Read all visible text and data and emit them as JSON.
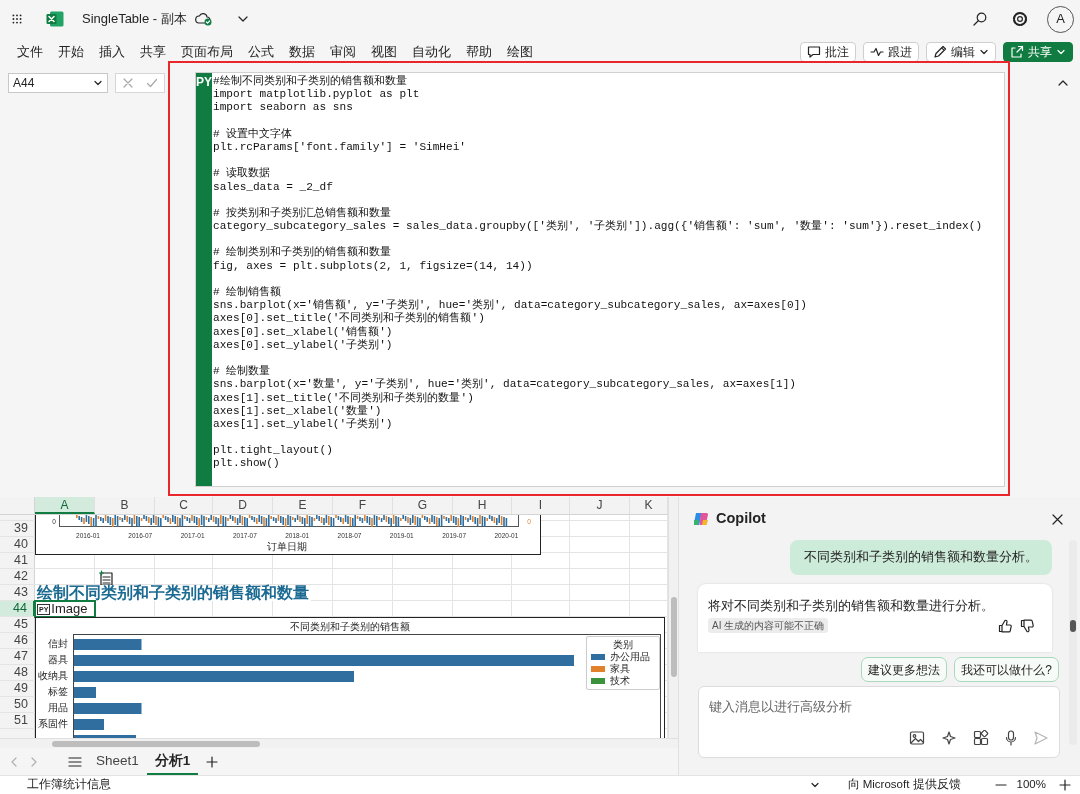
{
  "app_bar": {
    "title": "SingleTable - 副本",
    "avatar": "A"
  },
  "menu": [
    "文件",
    "开始",
    "插入",
    "共享",
    "页面布局",
    "公式",
    "数据",
    "审阅",
    "视图",
    "自动化",
    "帮助",
    "绘图"
  ],
  "ribbon_buttons": [
    {
      "label": "批注",
      "kind": "outline"
    },
    {
      "label": "跟进",
      "kind": "outline"
    },
    {
      "label": "编辑",
      "kind": "dropdown"
    },
    {
      "label": "共享",
      "kind": "primary"
    }
  ],
  "formula_bar": {
    "name_box": "A44",
    "editor": {
      "badge": "PY",
      "blocks": [
        [
          "#绘制不同类别和子类别的销售额和数量",
          "import matplotlib.pyplot as plt",
          "import seaborn as sns"
        ],
        [
          "# 设置中文字体",
          "plt.rcParams['font.family'] = 'SimHei'"
        ],
        [
          "# 读取数据",
          "sales_data = _2_df"
        ],
        [
          "# 按类别和子类别汇总销售额和数量",
          "category_subcategory_sales = sales_data.groupby(['类别', '子类别']).agg({'销售额': 'sum', '数量': 'sum'}).reset_index()"
        ],
        [
          "# 绘制类别和子类别的销售额和数量",
          "fig, axes = plt.subplots(2, 1, figsize=(14, 14))"
        ],
        [
          "# 绘制销售额",
          "sns.barplot(x='销售额', y='子类别', hue='类别', data=category_subcategory_sales, ax=axes[0])",
          "axes[0].set_title('不同类别和子类别的销售额')",
          "axes[0].set_xlabel('销售额')",
          "axes[0].set_ylabel('子类别')"
        ],
        [
          "# 绘制数量",
          "sns.barplot(x='数量', y='子类别', hue='类别', data=category_subcategory_sales, ax=axes[1])",
          "axes[1].set_title('不同类别和子类别的数量')",
          "axes[1].set_xlabel('数量')",
          "axes[1].set_ylabel('子类别')"
        ],
        [
          "plt.tight_layout()",
          "plt.show()"
        ]
      ]
    }
  },
  "sheet": {
    "columns": [
      {
        "label": "A",
        "selected": true
      },
      {
        "label": "B",
        "selected": false
      },
      {
        "label": "C",
        "selected": false
      },
      {
        "label": "D",
        "selected": false
      },
      {
        "label": "E",
        "selected": false
      },
      {
        "label": "F",
        "selected": false
      },
      {
        "label": "G",
        "selected": false
      },
      {
        "label": "H",
        "selected": false
      },
      {
        "label": "I",
        "selected": false
      },
      {
        "label": "J",
        "selected": false
      },
      {
        "label": "K",
        "selected": false
      }
    ],
    "rows": [
      {
        "label": "39",
        "selected": false
      },
      {
        "label": "40",
        "selected": false
      },
      {
        "label": "41",
        "selected": false
      },
      {
        "label": "42",
        "selected": false
      },
      {
        "label": "43",
        "selected": false
      },
      {
        "label": "44",
        "selected": true
      },
      {
        "label": "45",
        "selected": false
      },
      {
        "label": "46",
        "selected": false
      },
      {
        "label": "47",
        "selected": false
      },
      {
        "label": "48",
        "selected": false
      },
      {
        "label": "49",
        "selected": false
      },
      {
        "label": "50",
        "selected": false
      },
      {
        "label": "51",
        "selected": false
      }
    ],
    "heading": "绘制不同类别和子类别的销售额和数量",
    "active_cell": {
      "badge": "PY",
      "value": "Image"
    },
    "timeline_chart": {
      "left_tick": "0",
      "right_tick": "0",
      "xticks": [
        "2016-01",
        "2016-07",
        "2017-01",
        "2017-07",
        "2018-01",
        "2018-07",
        "2019-01",
        "2019-07",
        "2020-01"
      ],
      "xlabel": "订单日期"
    },
    "bar_chart": {
      "title": "不同类别和子类别的销售额",
      "categories": [
        "信封",
        "器具",
        "收纳具",
        "标签",
        "用品",
        "系固件"
      ],
      "legend_title": "类别",
      "legend": [
        {
          "label": "办公用品",
          "color": "#2f6e9e"
        },
        {
          "label": "家具",
          "color": "#e1812c"
        },
        {
          "label": "技术",
          "color": "#3a923a"
        }
      ]
    }
  },
  "sheet_tabs": [
    {
      "label": "Sheet1",
      "selected": false
    },
    {
      "label": "分析1",
      "selected": true
    }
  ],
  "copilot": {
    "title": "Copilot",
    "messages": [
      {
        "kind": "user",
        "text": "不同类别和子类别的销售额和数量分析。"
      },
      {
        "kind": "assistant",
        "text": "将对不同类别和子类别的销售额和数量进行分析。",
        "note": "AI 生成的内容可能不正确"
      }
    ],
    "suggestions": [
      "建议更多想法",
      "我还可以做什么?"
    ],
    "input": {
      "placeholder": "键入消息以进行高级分析"
    }
  },
  "status_bar": {
    "left": "工作簿统计信息",
    "feedback": "向 Microsoft 提供反馈",
    "zoom": "100%"
  }
}
